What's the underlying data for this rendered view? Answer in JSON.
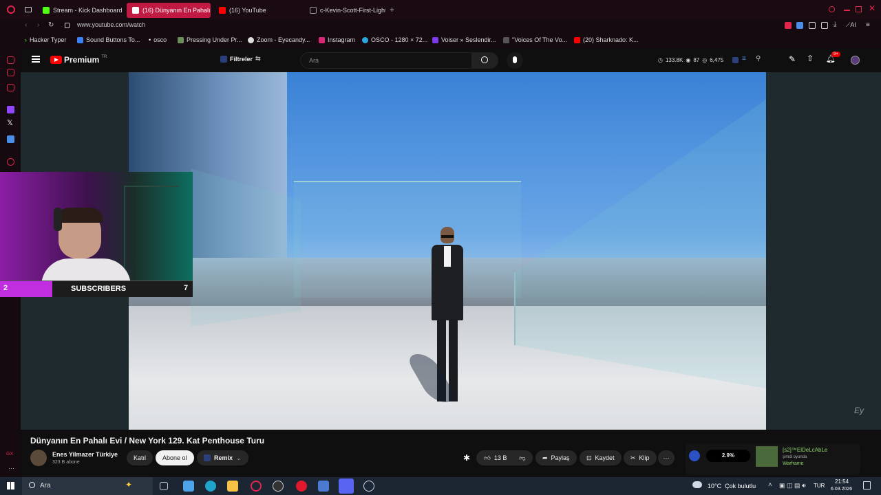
{
  "browser": {
    "tabs": [
      {
        "label": "Stream - Kick Dashboard",
        "active": false,
        "color": "#53fc18"
      },
      {
        "label": "(16) Dünyanın En Pahalı E",
        "active": true,
        "color": "#ff0000"
      },
      {
        "label": "(16) YouTube",
        "active": false,
        "color": "#ff0000"
      },
      {
        "label": "c-Kevin-Scott-First-Light",
        "active": false,
        "color": "#777777"
      }
    ],
    "url": "www.youtube.com/watch",
    "bookmarks": [
      {
        "label": "Hacker Typer",
        "icon": "chevron-right-icon"
      },
      {
        "label": "Sound Buttons To...",
        "icon": "sound-icon"
      },
      {
        "label": "osco",
        "icon": "dot-icon"
      },
      {
        "label": "Pressing Under Pr...",
        "icon": "globe-icon"
      },
      {
        "label": "Zoom - Eyecandy...",
        "icon": "zoom-icon"
      },
      {
        "label": "Instagram",
        "icon": "instagram-icon"
      },
      {
        "label": "OSCO - 1280 × 72...",
        "icon": "osco-icon"
      },
      {
        "label": "Voiser » Seslendir...",
        "icon": "voiser-icon"
      },
      {
        "label": "\"Voices Of The Vo...",
        "icon": "image-icon"
      },
      {
        "label": "(20) Sharknado: K...",
        "icon": "youtube-icon"
      }
    ],
    "ai_label": "AI",
    "accent": "#e0264d"
  },
  "youtube": {
    "logo": "Premium",
    "region": "TR",
    "filter_label": "Filtreler",
    "search_placeholder": "Ara",
    "stats": {
      "views": "133.8K",
      "likes": "87",
      "count3": "6,475"
    },
    "notif_badge": "9+"
  },
  "overlay": {
    "left_count": "2",
    "label": "SUBSCRIBERS",
    "right_count": "7"
  },
  "video": {
    "title": "Dünyanın En Pahalı Evi / New York 129. Kat Penthouse Turu",
    "channel": "Enes Yilmazer Türkiye",
    "subscribers": "323 B abone",
    "join_label": "Katıl",
    "subscribe_label": "Abone ol",
    "remix_label": "Remix",
    "likes": "13 B",
    "share_label": "Paylaş",
    "save_label": "Kaydet",
    "clip_label": "Klip",
    "watermark": "Ey"
  },
  "side_widget": {
    "percent": "2.9%",
    "user": "[s2]™ElDeLcAbLe",
    "status": "şimdi oyunda",
    "game": "Warframe"
  },
  "taskbar": {
    "search_placeholder": "Ara",
    "weather": "10°C  Çok bulutlu",
    "lang": "TUR",
    "time": "21:54",
    "date": "6.03.2026"
  }
}
